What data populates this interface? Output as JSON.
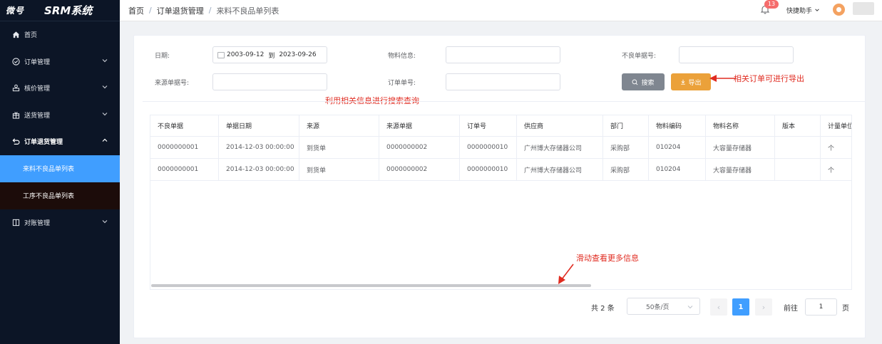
{
  "app": {
    "logo": "微号",
    "title": "SRM系统"
  },
  "breadcrumb": [
    "首页",
    "订单退货管理",
    "来料不良品单列表"
  ],
  "header": {
    "notification_count": "13",
    "helper_label": "快捷助手"
  },
  "sidebar": {
    "items": [
      {
        "label": "首页"
      },
      {
        "label": "订单管理"
      },
      {
        "label": "核价管理"
      },
      {
        "label": "送货管理"
      },
      {
        "label": "订单退货管理"
      },
      {
        "label": "对账管理"
      }
    ],
    "subitems": [
      {
        "label": "来料不良品单列表"
      },
      {
        "label": "工序不良品单列表"
      }
    ]
  },
  "filters": {
    "date_label": "日期:",
    "date_start": "2003-09-12",
    "date_to": "到",
    "date_end": "2023-09-26",
    "material_label": "物料信息:",
    "defect_no_label": "不良单据号:",
    "source_no_label": "来源单据号:",
    "order_no_label": "订单单号:",
    "search_label": "搜索",
    "export_label": "导出"
  },
  "annotations": {
    "export_note": "相关订单可进行导出",
    "search_note": "利用相关信息进行搜索查询",
    "scroll_note": "滑动查看更多信息"
  },
  "table": {
    "headers": [
      "不良单据",
      "单据日期",
      "来源",
      "来源单据",
      "订单号",
      "供应商",
      "部门",
      "物料编码",
      "物料名称",
      "版本",
      "计量单位"
    ],
    "rows": [
      [
        "0000000001",
        "2014-12-03 00:00:00",
        "到货单",
        "0000000002",
        "0000000010",
        "广州博大存储器公司",
        "采购部",
        "010204",
        "大容量存储器",
        "",
        "个"
      ],
      [
        "0000000001",
        "2014-12-03 00:00:00",
        "到货单",
        "0000000002",
        "0000000010",
        "广州博大存储器公司",
        "采购部",
        "010204",
        "大容量存储器",
        "",
        "个"
      ]
    ]
  },
  "pagination": {
    "total": "共 2 条",
    "page_size": "50条/页",
    "current_page": "1",
    "goto_label": "前往",
    "goto_value": "1",
    "page_suffix": "页"
  }
}
